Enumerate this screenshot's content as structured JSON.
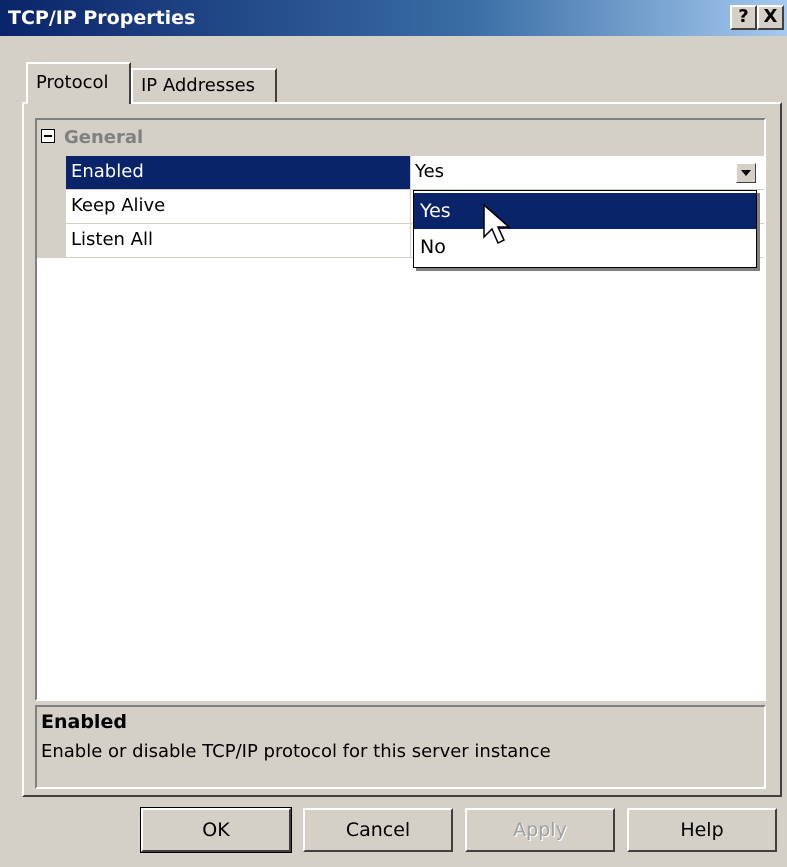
{
  "window": {
    "title": "TCP/IP Properties",
    "help_glyph": "?",
    "close_glyph": "X"
  },
  "tabs": [
    {
      "label": "Protocol",
      "active": true
    },
    {
      "label": "IP Addresses",
      "active": false
    }
  ],
  "grid": {
    "category": "General",
    "rows": [
      {
        "name": "Enabled",
        "value": "Yes",
        "selected": true
      },
      {
        "name": "Keep Alive",
        "value": ""
      },
      {
        "name": "Listen All",
        "value": ""
      }
    ]
  },
  "dropdown": {
    "options": [
      "Yes",
      "No"
    ],
    "highlighted": "Yes"
  },
  "description": {
    "title": "Enabled",
    "text": "Enable or disable TCP/IP protocol for this server instance"
  },
  "buttons": {
    "ok": "OK",
    "cancel": "Cancel",
    "apply": "Apply",
    "help": "Help"
  },
  "colors": {
    "selection": "#0a246a",
    "face": "#d4d0c8"
  }
}
